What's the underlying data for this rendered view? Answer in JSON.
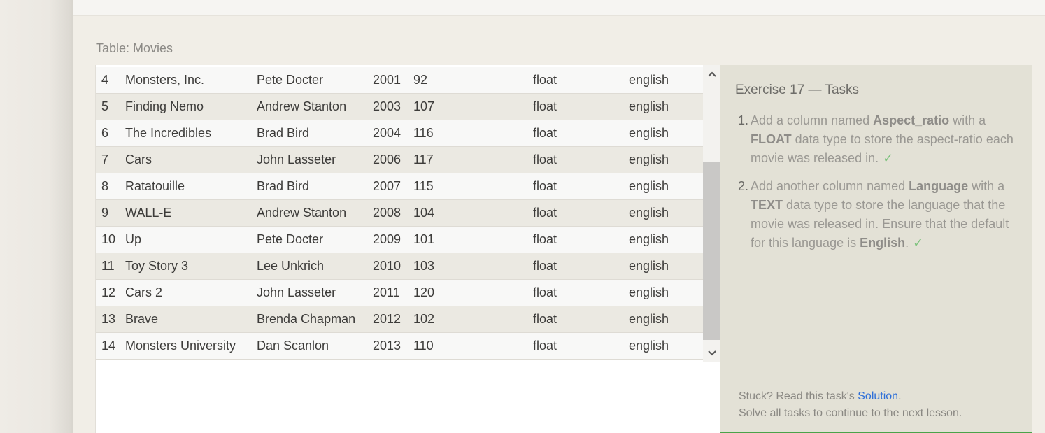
{
  "table": {
    "caption": "Table: Movies",
    "rows": [
      {
        "id": "4",
        "title": "Monsters, Inc.",
        "director": "Pete Docter",
        "year": "2001",
        "length": "92",
        "aspect_ratio": "float",
        "language": "english"
      },
      {
        "id": "5",
        "title": "Finding Nemo",
        "director": "Andrew Stanton",
        "year": "2003",
        "length": "107",
        "aspect_ratio": "float",
        "language": "english"
      },
      {
        "id": "6",
        "title": "The Incredibles",
        "director": "Brad Bird",
        "year": "2004",
        "length": "116",
        "aspect_ratio": "float",
        "language": "english"
      },
      {
        "id": "7",
        "title": "Cars",
        "director": "John Lasseter",
        "year": "2006",
        "length": "117",
        "aspect_ratio": "float",
        "language": "english"
      },
      {
        "id": "8",
        "title": "Ratatouille",
        "director": "Brad Bird",
        "year": "2007",
        "length": "115",
        "aspect_ratio": "float",
        "language": "english"
      },
      {
        "id": "9",
        "title": "WALL-E",
        "director": "Andrew Stanton",
        "year": "2008",
        "length": "104",
        "aspect_ratio": "float",
        "language": "english"
      },
      {
        "id": "10",
        "title": "Up",
        "director": "Pete Docter",
        "year": "2009",
        "length": "101",
        "aspect_ratio": "float",
        "language": "english"
      },
      {
        "id": "11",
        "title": "Toy Story 3",
        "director": "Lee Unkrich",
        "year": "2010",
        "length": "103",
        "aspect_ratio": "float",
        "language": "english"
      },
      {
        "id": "12",
        "title": "Cars 2",
        "director": "John Lasseter",
        "year": "2011",
        "length": "120",
        "aspect_ratio": "float",
        "language": "english"
      },
      {
        "id": "13",
        "title": "Brave",
        "director": "Brenda Chapman",
        "year": "2012",
        "length": "102",
        "aspect_ratio": "float",
        "language": "english"
      },
      {
        "id": "14",
        "title": "Monsters University",
        "director": "Dan Scanlon",
        "year": "2013",
        "length": "110",
        "aspect_ratio": "float",
        "language": "english"
      }
    ],
    "scroll_up_icon": "chevron-up-icon",
    "scroll_down_icon": "chevron-down-icon"
  },
  "tasks": {
    "title": "Exercise 17 — Tasks",
    "items": [
      {
        "num": "1.",
        "t1": "Add a column named ",
        "b1": "Aspect_ratio",
        "t2": " with a ",
        "b2": "FLOAT",
        "t3": " data type to store the aspect-ratio each movie was released in.",
        "check": "✓"
      },
      {
        "num": "2.",
        "t1": "Add another column named ",
        "b1": "Language",
        "t2": " with a ",
        "b2": "TEXT",
        "t3": " data type to store the language that the movie was released in. Ensure that the default for this language is ",
        "b3": "English",
        "t4": ".",
        "check": "✓"
      }
    ],
    "footer": {
      "stuck_prefix": "Stuck? Read this task's ",
      "solution_link": "Solution",
      "stuck_suffix": ".",
      "continue_text": "Solve all tasks to continue to the next lesson."
    }
  },
  "colors": {
    "accent_link": "#2e6fd8",
    "check": "#7dc27d",
    "progress_bar": "#4aa34a"
  }
}
